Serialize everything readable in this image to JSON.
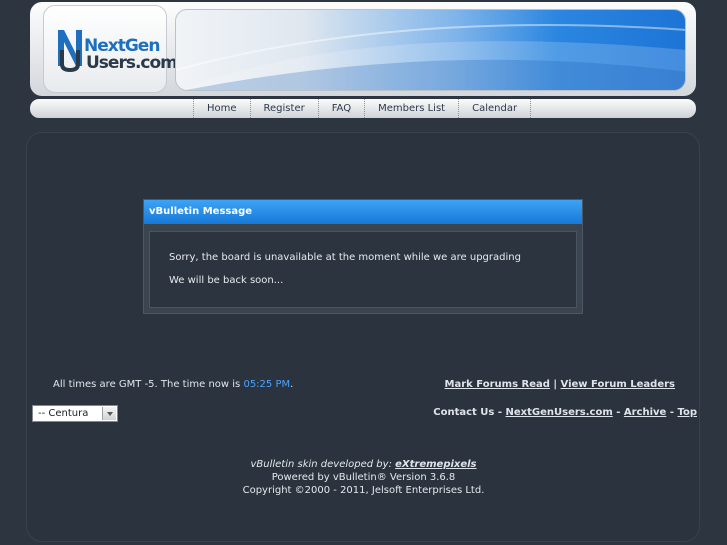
{
  "header": {
    "logo_top": "NextGen",
    "logo_bottom": "Users.com",
    "logo_letters": "NU"
  },
  "nav": {
    "items": [
      {
        "label": "Home"
      },
      {
        "label": "Register"
      },
      {
        "label": "FAQ"
      },
      {
        "label": "Members List"
      },
      {
        "label": "Calendar"
      }
    ]
  },
  "message": {
    "title": "vBulletin Message",
    "line1": "Sorry, the board is unavailable at the moment while we are upgrading",
    "line2": "We will be back soon..."
  },
  "footer": {
    "timezone_text": "All times are GMT -5. The time now is",
    "time": "05:25 PM",
    "time_suffix": ".",
    "mark_read": "Mark Forums Read",
    "separator": "|",
    "view_leaders": "View Forum Leaders",
    "contact": "Contact Us",
    "site": "NextGenUsers.com",
    "archive": "Archive",
    "top": "Top",
    "dash": "-",
    "style_select": "-- Centura"
  },
  "credits": {
    "skin_prefix": "vBulletin skin developed by:",
    "skin_author": "eXtremepixels",
    "powered": "Powered by vBulletin® Version 3.6.8",
    "copyright": "Copyright ©2000 - 2011, Jelsoft Enterprises Ltd."
  },
  "colors": {
    "background": "#2d3640",
    "accent": "#1679d8",
    "time_link": "#4aa3ff"
  }
}
